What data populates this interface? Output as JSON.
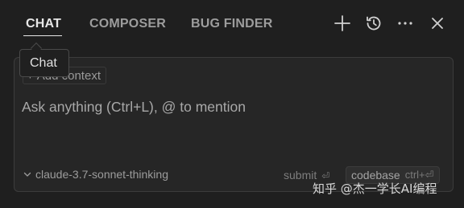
{
  "tabs": [
    {
      "label": "CHAT",
      "active": true
    },
    {
      "label": "COMPOSER",
      "active": false
    },
    {
      "label": "BUG FINDER",
      "active": false
    }
  ],
  "header_icons": [
    "plus-icon",
    "history-icon",
    "more-icon",
    "close-icon"
  ],
  "tooltip": {
    "text": "Chat"
  },
  "panel": {
    "add_context_label": "Add context",
    "input": {
      "value": "",
      "placeholder": "Ask anything (Ctrl+L), @ to mention"
    },
    "model": {
      "selected": "claude-3.7-sonnet-thinking"
    },
    "submit_label": "submit",
    "submit_shortcut": "⏎",
    "codebase_label": "codebase",
    "codebase_shortcut": "ctrl+⏎"
  },
  "watermark": "知乎 @杰一学长AI编程",
  "colors": {
    "background": "#1f1f1f",
    "panel": "#262626",
    "active_tab": "#e7e7e7",
    "inactive_tab": "#9d9d9d"
  }
}
